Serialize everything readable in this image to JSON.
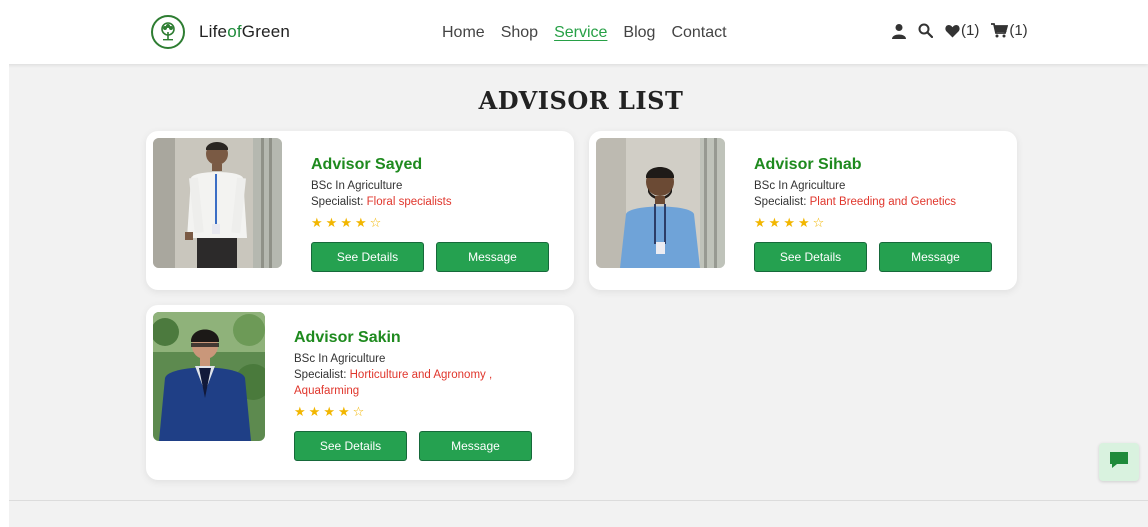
{
  "brand": {
    "name_part1": "Life",
    "name_part2": "of",
    "name_part3": "Green"
  },
  "nav": {
    "links": [
      {
        "label": "Home"
      },
      {
        "label": "Shop"
      },
      {
        "label": "Service"
      },
      {
        "label": "Blog"
      },
      {
        "label": "Contact"
      }
    ],
    "active": "Service",
    "wishlist_count": "(1)",
    "cart_count": "(1)"
  },
  "page_title": "ADVISOR LIST",
  "advisors": [
    {
      "name": "Advisor Sayed",
      "degree": "BSc In Agriculture",
      "specialist_label": "Specialist:",
      "specialist": "Floral specialists",
      "rating": 4,
      "details_label": "See Details",
      "message_label": "Message"
    },
    {
      "name": "Advisor Sihab",
      "degree": "BSc In Agriculture",
      "specialist_label": "Specialist:",
      "specialist": "Plant Breeding and Genetics",
      "rating": 4,
      "details_label": "See Details",
      "message_label": "Message"
    },
    {
      "name": "Advisor Sakin",
      "degree": "BSc In Agriculture",
      "specialist_label": "Specialist:",
      "specialist": "Horticulture and Agronomy ,",
      "specialist_line2": "Aquafarming",
      "rating": 4,
      "details_label": "See Details",
      "message_label": "Message"
    }
  ],
  "colors": {
    "brand_green": "#25a150",
    "name_green": "#1e8a1e",
    "specialist_red": "#e0362c",
    "star": "#f2b600"
  },
  "icons": [
    "tree-logo-icon",
    "user-icon",
    "search-icon",
    "heart-icon",
    "cart-icon",
    "chat-icon"
  ]
}
